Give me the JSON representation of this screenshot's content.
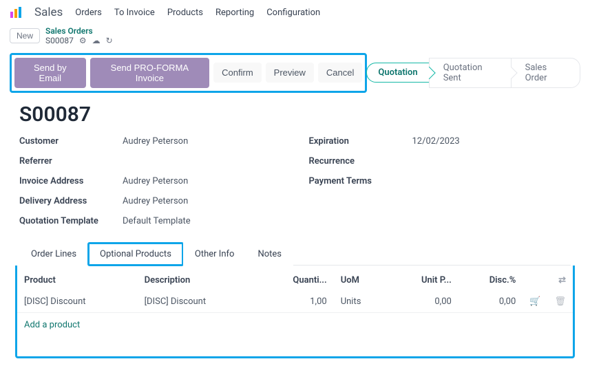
{
  "app": {
    "name": "Sales",
    "menu": [
      "Orders",
      "To Invoice",
      "Products",
      "Reporting",
      "Configuration"
    ]
  },
  "toolbar": {
    "new_label": "New",
    "breadcrumb_root": "Sales Orders",
    "record_id": "S00087"
  },
  "actions": {
    "send_email": "Send by Email",
    "send_proforma": "Send PRO-FORMA Invoice",
    "confirm": "Confirm",
    "preview": "Preview",
    "cancel": "Cancel"
  },
  "stages": {
    "quotation": "Quotation",
    "quotation_sent": "Quotation Sent",
    "sales_order": "Sales Order"
  },
  "record": {
    "title": "S00087",
    "fields": {
      "customer_label": "Customer",
      "customer_value": "Audrey Peterson",
      "referrer_label": "Referrer",
      "referrer_value": "",
      "invoice_addr_label": "Invoice Address",
      "invoice_addr_value": "Audrey Peterson",
      "delivery_addr_label": "Delivery Address",
      "delivery_addr_value": "Audrey Peterson",
      "quote_tmpl_label": "Quotation Template",
      "quote_tmpl_value": "Default Template",
      "expiration_label": "Expiration",
      "expiration_value": "12/02/2023",
      "recurrence_label": "Recurrence",
      "recurrence_value": "",
      "payment_terms_label": "Payment Terms",
      "payment_terms_value": ""
    }
  },
  "tabs": {
    "order_lines": "Order Lines",
    "optional_products": "Optional Products",
    "other_info": "Other Info",
    "notes": "Notes"
  },
  "optional_products": {
    "headers": {
      "product": "Product",
      "description": "Description",
      "quantity": "Quanti...",
      "uom": "UoM",
      "unit_price": "Unit P...",
      "discount": "Disc.%"
    },
    "rows": [
      {
        "product": "[DISC] Discount",
        "description": "[DISC] Discount",
        "quantity": "1,00",
        "uom": "Units",
        "unit_price": "0,00",
        "discount": "0,00"
      }
    ],
    "add_label": "Add a product"
  }
}
